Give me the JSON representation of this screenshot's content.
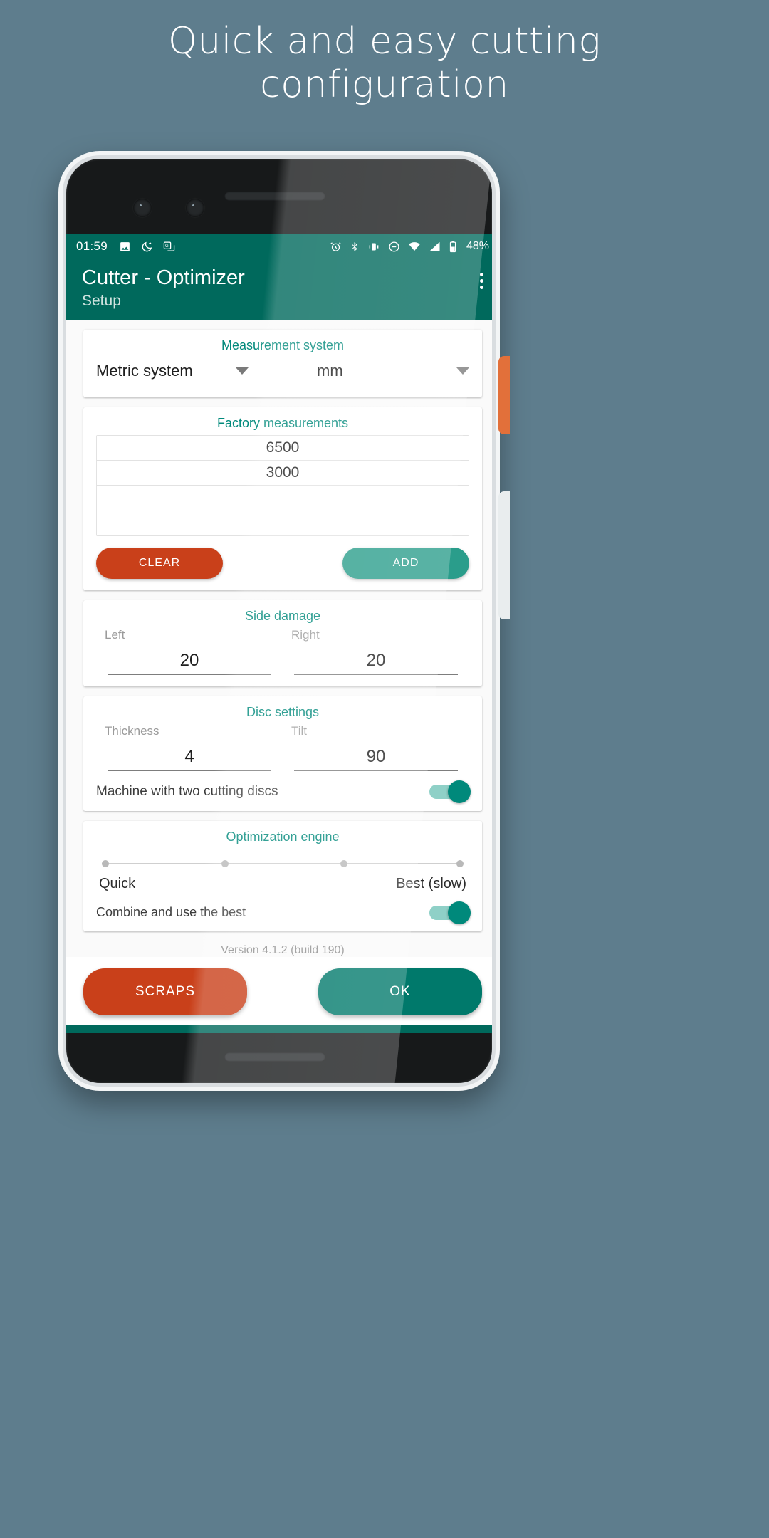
{
  "promo": {
    "line1": "Quick and easy cutting",
    "line2": "configuration"
  },
  "statusbar": {
    "time": "01:59",
    "left_icons": [
      "image-icon",
      "do-not-disturb-moon-icon",
      "google-translate-icon"
    ],
    "right_icons": [
      "alarm-icon",
      "bluetooth-icon",
      "vibrate-icon",
      "dnd-icon",
      "wifi-icon",
      "cell-signal-icon",
      "battery-icon"
    ],
    "battery_percent": "48%"
  },
  "appbar": {
    "title": "Cutter - Optimizer",
    "subtitle": "Setup",
    "overflow": "overflow-menu-icon"
  },
  "measurement_card": {
    "title": "Measurement system",
    "system_value": "Metric system",
    "unit_value": "mm"
  },
  "factory_card": {
    "title": "Factory measurements",
    "values": [
      "6500",
      "3000"
    ],
    "clear_label": "CLEAR",
    "add_label": "ADD"
  },
  "side_damage_card": {
    "title": "Side damage",
    "left_label": "Left",
    "left_value": "20",
    "right_label": "Right",
    "right_value": "20"
  },
  "disc_card": {
    "title": "Disc settings",
    "thickness_label": "Thickness",
    "thickness_value": "4",
    "tilt_label": "Tilt",
    "tilt_value": "90",
    "switch_label": "Machine with two cutting discs",
    "switch_on": true
  },
  "engine_card": {
    "title": "Optimization engine",
    "slider_min_label": "Quick",
    "slider_max_label": "Best (slow)",
    "slider_stops": 4,
    "switch_label": "Combine and use the best",
    "switch_on": true
  },
  "version": "Version 4.1.2 (build 190)",
  "bottom": {
    "scraps_label": "SCRAPS",
    "ok_label": "OK"
  },
  "colors": {
    "background": "#5e7d8d",
    "primary_dark": "#00695c",
    "accent_teal": "#00897b",
    "accent_orange": "#c9401a"
  }
}
